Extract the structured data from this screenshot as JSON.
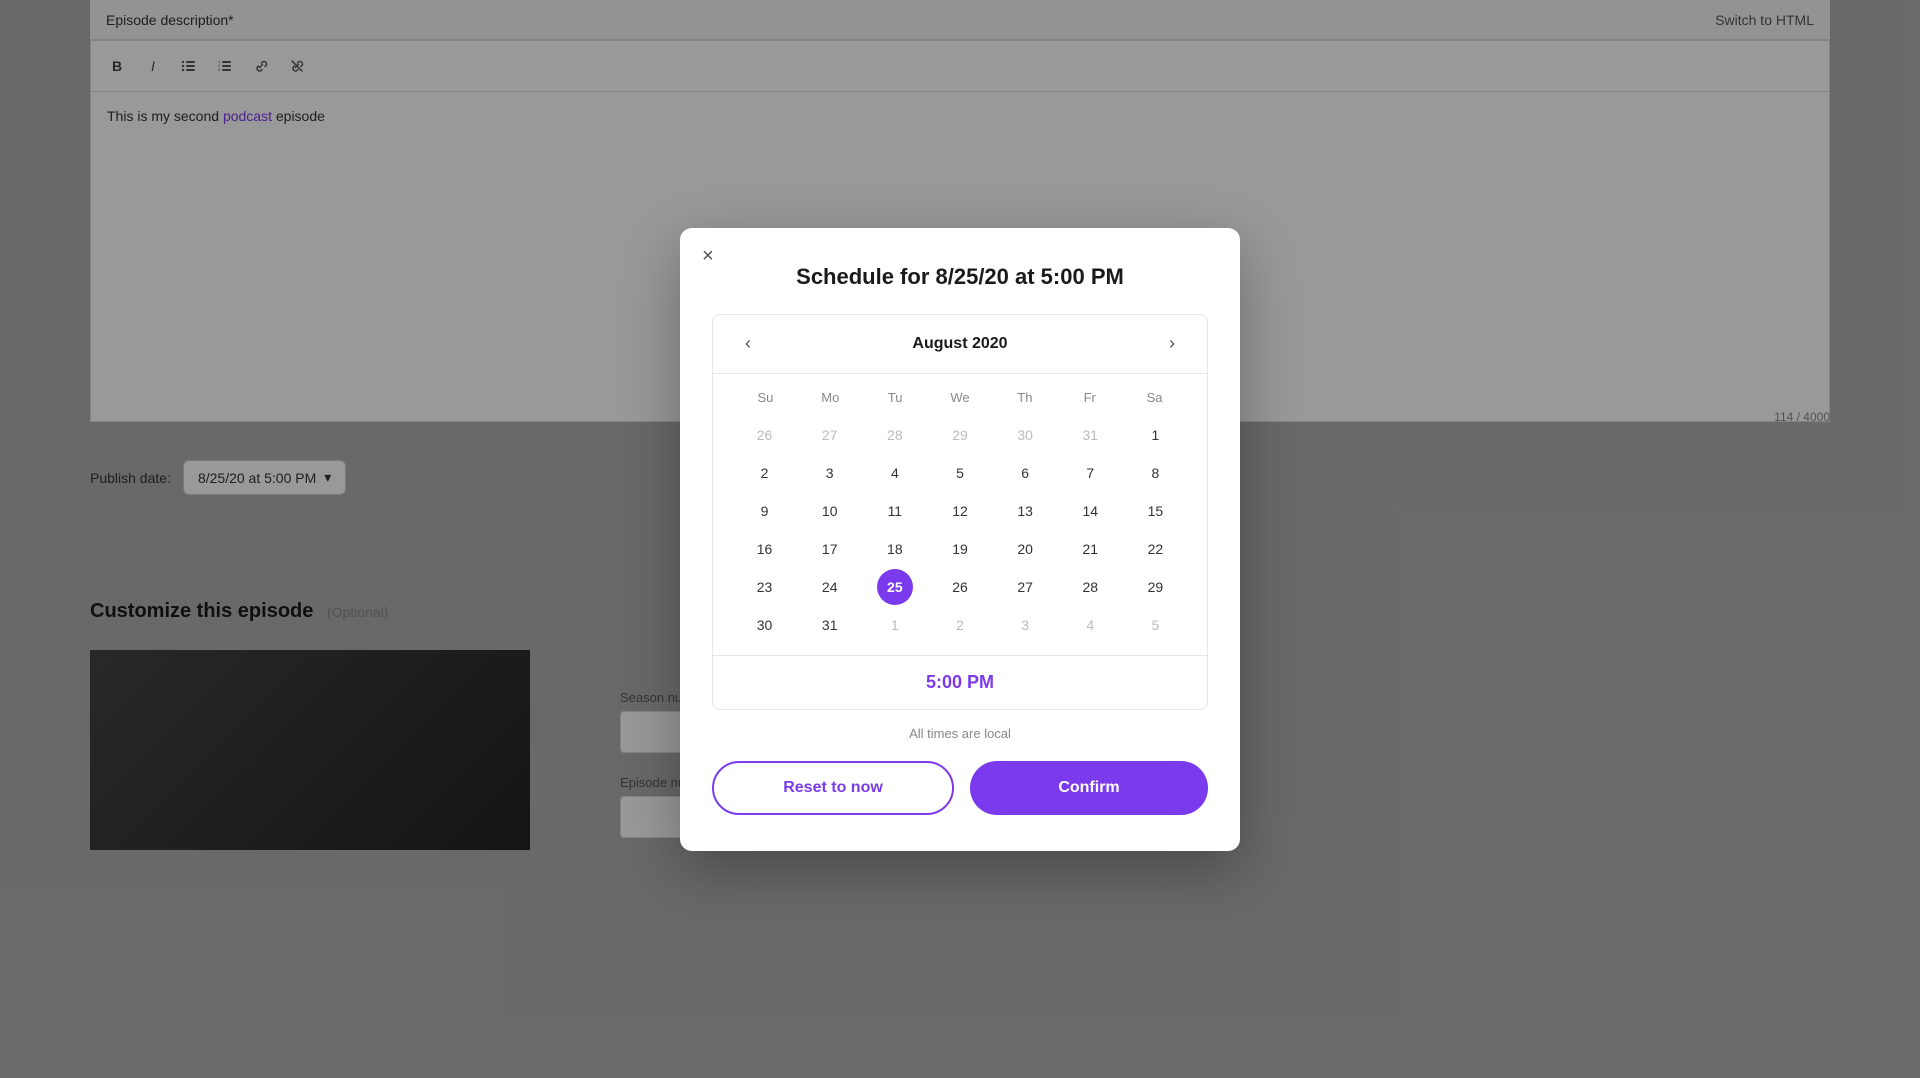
{
  "page": {
    "background_color": "#b0b0b0"
  },
  "background": {
    "episode_desc_label": "Episode description*",
    "switch_html_label": "Switch to HTML",
    "toolbar": {
      "bold": "B",
      "italic": "I",
      "bullet_list": "•",
      "numbered_list": "1.",
      "link": "🔗",
      "unlink": "✂"
    },
    "editor_text_prefix": "This is my second ",
    "editor_link_text": "podcast",
    "editor_text_suffix": " episode",
    "char_count": "114 / 4000",
    "publish_date_label": "Publish date:",
    "publish_date_value": "8/25/20 at 5:00 PM",
    "customize_heading": "Customize this episode",
    "customize_optional": "(Optional)",
    "season_number_label": "Season number",
    "episode_number_label": "Episode number"
  },
  "modal": {
    "title": "Schedule for 8/25/20 at 5:00 PM",
    "close_icon": "×",
    "calendar": {
      "month_year": "August 2020",
      "prev_icon": "‹",
      "next_icon": "›",
      "weekdays": [
        "Su",
        "Mo",
        "Tu",
        "We",
        "Th",
        "Fr",
        "Sa"
      ],
      "weeks": [
        [
          {
            "day": "26",
            "type": "other-month"
          },
          {
            "day": "27",
            "type": "other-month"
          },
          {
            "day": "28",
            "type": "other-month"
          },
          {
            "day": "29",
            "type": "other-month"
          },
          {
            "day": "30",
            "type": "other-month"
          },
          {
            "day": "31",
            "type": "other-month"
          },
          {
            "day": "1",
            "type": "current-month"
          }
        ],
        [
          {
            "day": "2",
            "type": "current-month"
          },
          {
            "day": "3",
            "type": "current-month"
          },
          {
            "day": "4",
            "type": "current-month"
          },
          {
            "day": "5",
            "type": "current-month"
          },
          {
            "day": "6",
            "type": "current-month"
          },
          {
            "day": "7",
            "type": "current-month"
          },
          {
            "day": "8",
            "type": "current-month"
          }
        ],
        [
          {
            "day": "9",
            "type": "current-month"
          },
          {
            "day": "10",
            "type": "current-month"
          },
          {
            "day": "11",
            "type": "current-month"
          },
          {
            "day": "12",
            "type": "current-month"
          },
          {
            "day": "13",
            "type": "current-month"
          },
          {
            "day": "14",
            "type": "current-month"
          },
          {
            "day": "15",
            "type": "current-month"
          }
        ],
        [
          {
            "day": "16",
            "type": "current-month"
          },
          {
            "day": "17",
            "type": "current-month"
          },
          {
            "day": "18",
            "type": "current-month"
          },
          {
            "day": "19",
            "type": "current-month"
          },
          {
            "day": "20",
            "type": "current-month"
          },
          {
            "day": "21",
            "type": "current-month"
          },
          {
            "day": "22",
            "type": "current-month"
          }
        ],
        [
          {
            "day": "23",
            "type": "current-month"
          },
          {
            "day": "24",
            "type": "current-month"
          },
          {
            "day": "25",
            "type": "selected"
          },
          {
            "day": "26",
            "type": "current-month"
          },
          {
            "day": "27",
            "type": "current-month"
          },
          {
            "day": "28",
            "type": "current-month"
          },
          {
            "day": "29",
            "type": "current-month"
          }
        ],
        [
          {
            "day": "30",
            "type": "current-month"
          },
          {
            "day": "31",
            "type": "current-month"
          },
          {
            "day": "1",
            "type": "other-month"
          },
          {
            "day": "2",
            "type": "other-month"
          },
          {
            "day": "3",
            "type": "other-month"
          },
          {
            "day": "4",
            "type": "other-month"
          },
          {
            "day": "5",
            "type": "other-month"
          }
        ]
      ]
    },
    "time": "5:00 PM",
    "local_time_note": "All times are local",
    "reset_button": "Reset to now",
    "confirm_button": "Confirm"
  },
  "colors": {
    "accent": "#7c3aed",
    "text_dark": "#1a1a1a",
    "text_muted": "#888",
    "border": "#e5e5e5"
  }
}
